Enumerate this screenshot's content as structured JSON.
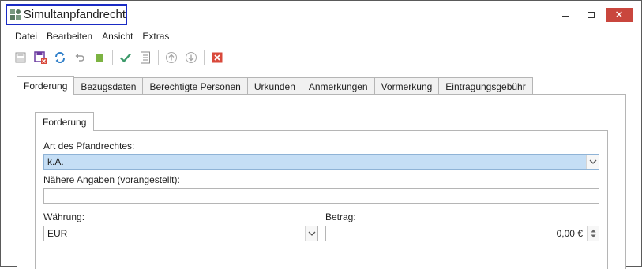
{
  "window": {
    "title": "Simultanpfandrecht",
    "close_glyph": "✕"
  },
  "menu": [
    "Datei",
    "Bearbeiten",
    "Ansicht",
    "Extras"
  ],
  "toolbar": {
    "icons": [
      "save-icon",
      "save-close-icon",
      "refresh-icon",
      "undo-icon",
      "stop-icon",
      "confirm-check-icon",
      "document-list-icon",
      "move-up-icon",
      "move-down-icon",
      "delete-icon"
    ],
    "colors": {
      "refresh": "#2f7fc9",
      "check": "#3c9a6a",
      "square": "#7cb342",
      "delete": "#d9493b",
      "save_close": "#6b3aa0"
    }
  },
  "tabs": [
    "Forderung",
    "Bezugsdaten",
    "Berechtigte Personen",
    "Urkunden",
    "Anmerkungen",
    "Vormerkung",
    "Eintragungsgebühr"
  ],
  "active_tab": "Forderung",
  "inner_tab": "Forderung",
  "form": {
    "art_label": "Art des Pfandrechtes:",
    "art_value": "k.A.",
    "naehere_label": "Nähere Angaben (vorangestellt):",
    "naehere_value": "",
    "waehrung_label": "Währung:",
    "waehrung_value": "EUR",
    "betrag_label": "Betrag:",
    "betrag_value": "0,00 €"
  }
}
